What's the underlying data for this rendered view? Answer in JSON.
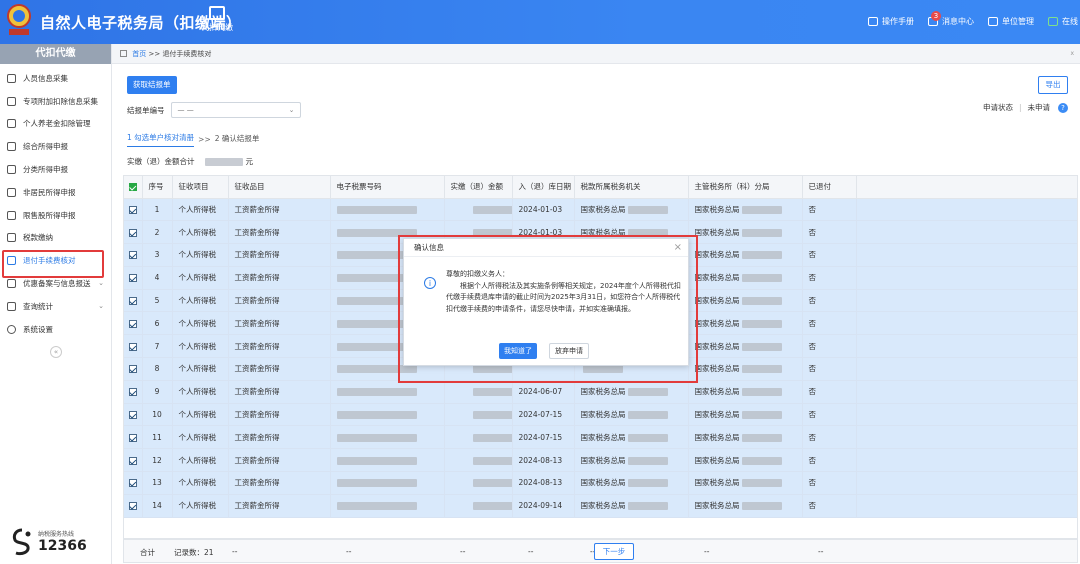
{
  "header": {
    "app_title": "自然人电子税务局（扣缴端）",
    "module_label": "代扣代缴",
    "manual": "操作手册",
    "message_center": "消息中心",
    "message_badge": "3",
    "unit_mgmt": "单位管理",
    "online": "在线"
  },
  "sidebar": {
    "heading": "代扣代缴",
    "items": [
      {
        "label": "人员信息采集"
      },
      {
        "label": "专项附加扣除信息采集"
      },
      {
        "label": "个人养老金扣除管理"
      },
      {
        "label": "综合所得申报"
      },
      {
        "label": "分类所得申报"
      },
      {
        "label": "非居民所得申报"
      },
      {
        "label": "限售股所得申报"
      },
      {
        "label": "税款缴纳"
      },
      {
        "label": "退付手续费核对"
      },
      {
        "label": "优惠备案与信息报送"
      },
      {
        "label": "查询统计"
      },
      {
        "label": "系统设置"
      }
    ],
    "collapse": "«",
    "hotline_caption": "纳税服务热线",
    "hotline_number": "12366"
  },
  "breadcrumb": {
    "home": "首页",
    "separator": ">>",
    "current": "退付手续费核对",
    "close": "x"
  },
  "main": {
    "fetch_button": "获取结报单",
    "export_button": "导出",
    "report_no_label": "结报单编号",
    "report_no_value": "— —",
    "apply_status_label": "申请状态",
    "apply_status_sep": "|",
    "apply_status_value": "未申请",
    "help": "?",
    "step1": "1 勾选单户核对清册",
    "step_sep": ">>",
    "step2": "2 确认结报单",
    "total_label": "实缴（退）金额合计",
    "total_unit": "元",
    "next_button": "下一步"
  },
  "table": {
    "headers": [
      "序号",
      "征收项目",
      "征收品目",
      "电子税票号码",
      "实缴（退）金额",
      "入（退）库日期",
      "税款所属税务机关",
      "主管税务所（科）分局",
      "已退付"
    ],
    "rows": [
      {
        "idx": "1",
        "project": "个人所得税",
        "item": "工资薪金所得",
        "date": "2024-01-03",
        "office": "国家税务总局",
        "branch": "国家税务总局",
        "refunded": "否"
      },
      {
        "idx": "2",
        "project": "个人所得税",
        "item": "工资薪金所得",
        "date": "2024-01-03",
        "office": "国家税务总局",
        "branch": "国家税务总局",
        "refunded": "否"
      },
      {
        "idx": "3",
        "project": "个人所得税",
        "item": "工资薪金所得",
        "date": "",
        "office": "",
        "branch": "国家税务总局",
        "refunded": "否"
      },
      {
        "idx": "4",
        "project": "个人所得税",
        "item": "工资薪金所得",
        "date": "",
        "office": "",
        "branch": "国家税务总局",
        "refunded": "否"
      },
      {
        "idx": "5",
        "project": "个人所得税",
        "item": "工资薪金所得",
        "date": "",
        "office": "",
        "branch": "国家税务总局",
        "refunded": "否"
      },
      {
        "idx": "6",
        "project": "个人所得税",
        "item": "工资薪金所得",
        "date": "",
        "office": "",
        "branch": "国家税务总局",
        "refunded": "否"
      },
      {
        "idx": "7",
        "project": "个人所得税",
        "item": "工资薪金所得",
        "date": "",
        "office": "",
        "branch": "国家税务总局",
        "refunded": "否"
      },
      {
        "idx": "8",
        "project": "个人所得税",
        "item": "工资薪金所得",
        "date": "",
        "office": "",
        "branch": "国家税务总局",
        "refunded": "否"
      },
      {
        "idx": "9",
        "project": "个人所得税",
        "item": "工资薪金所得",
        "date": "2024-06-07",
        "office": "国家税务总局",
        "branch": "国家税务总局",
        "refunded": "否"
      },
      {
        "idx": "10",
        "project": "个人所得税",
        "item": "工资薪金所得",
        "date": "2024-07-15",
        "office": "国家税务总局",
        "branch": "国家税务总局",
        "refunded": "否"
      },
      {
        "idx": "11",
        "project": "个人所得税",
        "item": "工资薪金所得",
        "date": "2024-07-15",
        "office": "国家税务总局",
        "branch": "国家税务总局",
        "refunded": "否"
      },
      {
        "idx": "12",
        "project": "个人所得税",
        "item": "工资薪金所得",
        "date": "2024-08-13",
        "office": "国家税务总局",
        "branch": "国家税务总局",
        "refunded": "否"
      },
      {
        "idx": "13",
        "project": "个人所得税",
        "item": "工资薪金所得",
        "date": "2024-08-13",
        "office": "国家税务总局",
        "branch": "国家税务总局",
        "refunded": "否"
      },
      {
        "idx": "14",
        "project": "个人所得税",
        "item": "工资薪金所得",
        "date": "2024-09-14",
        "office": "国家税务总局",
        "branch": "国家税务总局",
        "refunded": "否"
      }
    ],
    "summary_label": "合计",
    "summary_count": "记录数：21",
    "summary_dash": "--"
  },
  "modal": {
    "title": "确认信息",
    "close": "×",
    "greeting": "尊敬的扣缴义务人：",
    "body": "根据个人所得税法及其实施条例等相关规定，2024年度个人所得税代扣代缴手续费退库申请的截止时间为2025年3月31日，如您符合个人所得税代扣代缴手续费的申请条件，请您尽快申请，并如实准确填报。",
    "ok_button": "我知道了",
    "cancel_button": "放弃申请"
  },
  "colors": {
    "header_blue": "#3a86f2",
    "primary": "#2f7ff0",
    "row_selected": "#d9e9fb",
    "highlight_red": "#e23b3b"
  }
}
